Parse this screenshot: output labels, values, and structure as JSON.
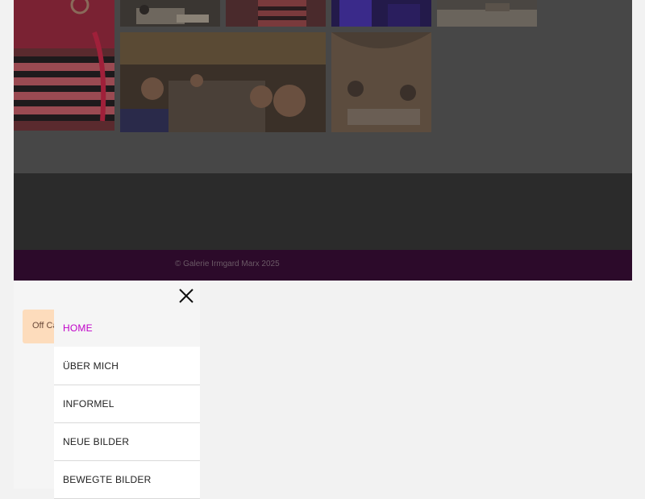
{
  "footer": {
    "copyright": "© Galerie Irmgard Marx 2025"
  },
  "offcanvas": {
    "close_icon": "close-icon",
    "toggle_label": "Off Canvas",
    "menu": [
      {
        "label": "HOME",
        "active": true
      },
      {
        "label": "ÜBER MICH",
        "active": false
      },
      {
        "label": "INFORMEL",
        "active": false
      },
      {
        "label": "NEUE BILDER",
        "active": false
      },
      {
        "label": "BEWEGTE BILDER",
        "active": false
      }
    ]
  },
  "colors": {
    "active_menu": "#c000c8",
    "footer_bar": "#2c0a2a",
    "toggle_bg": "#fddcbc"
  }
}
